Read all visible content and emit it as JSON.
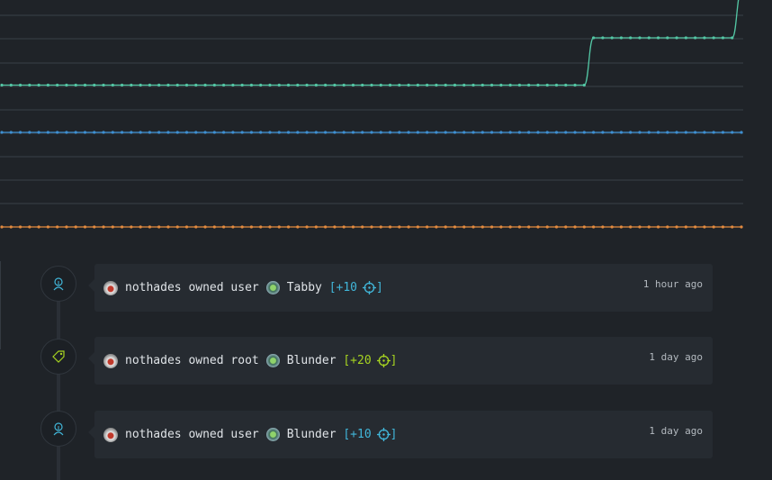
{
  "chart_data": {
    "type": "line",
    "grid": true,
    "series": [
      {
        "color": "#53c6a4",
        "values": [
          3,
          3,
          3,
          3,
          3,
          3,
          3,
          3,
          3,
          3,
          3,
          3,
          3,
          3,
          3,
          3,
          3,
          3,
          3,
          3,
          3,
          3,
          3,
          3,
          3,
          3,
          3,
          3,
          3,
          3,
          3,
          3,
          3,
          3,
          3,
          3,
          3,
          3,
          3,
          3,
          3,
          3,
          3,
          3,
          3,
          3,
          3,
          3,
          3,
          3,
          3,
          3,
          3,
          3,
          3,
          3,
          3,
          3,
          3,
          3,
          3,
          3,
          3,
          3,
          4,
          4,
          4,
          4,
          4,
          4,
          4,
          4,
          4,
          4,
          4,
          4,
          4,
          4,
          4,
          4,
          5
        ]
      },
      {
        "color": "#3e8fd1",
        "values": [
          2,
          2,
          2,
          2,
          2,
          2,
          2,
          2,
          2,
          2,
          2,
          2,
          2,
          2,
          2,
          2,
          2,
          2,
          2,
          2,
          2,
          2,
          2,
          2,
          2,
          2,
          2,
          2,
          2,
          2,
          2,
          2,
          2,
          2,
          2,
          2,
          2,
          2,
          2,
          2,
          2,
          2,
          2,
          2,
          2,
          2,
          2,
          2,
          2,
          2,
          2,
          2,
          2,
          2,
          2,
          2,
          2,
          2,
          2,
          2,
          2,
          2,
          2,
          2,
          2,
          2,
          2,
          2,
          2,
          2,
          2,
          2,
          2,
          2,
          2,
          2,
          2,
          2,
          2,
          2,
          2
        ]
      },
      {
        "color": "#e28a3f",
        "values": [
          0,
          0,
          0,
          0,
          0,
          0,
          0,
          0,
          0,
          0,
          0,
          0,
          0,
          0,
          0,
          0,
          0,
          0,
          0,
          0,
          0,
          0,
          0,
          0,
          0,
          0,
          0,
          0,
          0,
          0,
          0,
          0,
          0,
          0,
          0,
          0,
          0,
          0,
          0,
          0,
          0,
          0,
          0,
          0,
          0,
          0,
          0,
          0,
          0,
          0,
          0,
          0,
          0,
          0,
          0,
          0,
          0,
          0,
          0,
          0,
          0,
          0,
          0,
          0,
          0,
          0,
          0,
          0,
          0,
          0,
          0,
          0,
          0,
          0,
          0,
          0,
          0,
          0,
          0,
          0,
          0
        ]
      }
    ]
  },
  "colors": {
    "user_points": "#41b6d9",
    "root_points": "#a6d321"
  },
  "activities": [
    {
      "kind": "user",
      "marker_icon": "user-icon",
      "player": "nothades",
      "action": "owned user",
      "machine": "Tabby",
      "points_text": "[+10",
      "close_text": "]",
      "time": "1 hour ago"
    },
    {
      "kind": "root",
      "marker_icon": "tag-icon",
      "player": "nothades",
      "action": "owned root",
      "machine": "Blunder",
      "points_text": "[+20",
      "close_text": "]",
      "time": "1 day ago"
    },
    {
      "kind": "user",
      "marker_icon": "user-icon",
      "player": "nothades",
      "action": "owned user",
      "machine": "Blunder",
      "points_text": "[+10",
      "close_text": "]",
      "time": "1 day ago"
    }
  ]
}
